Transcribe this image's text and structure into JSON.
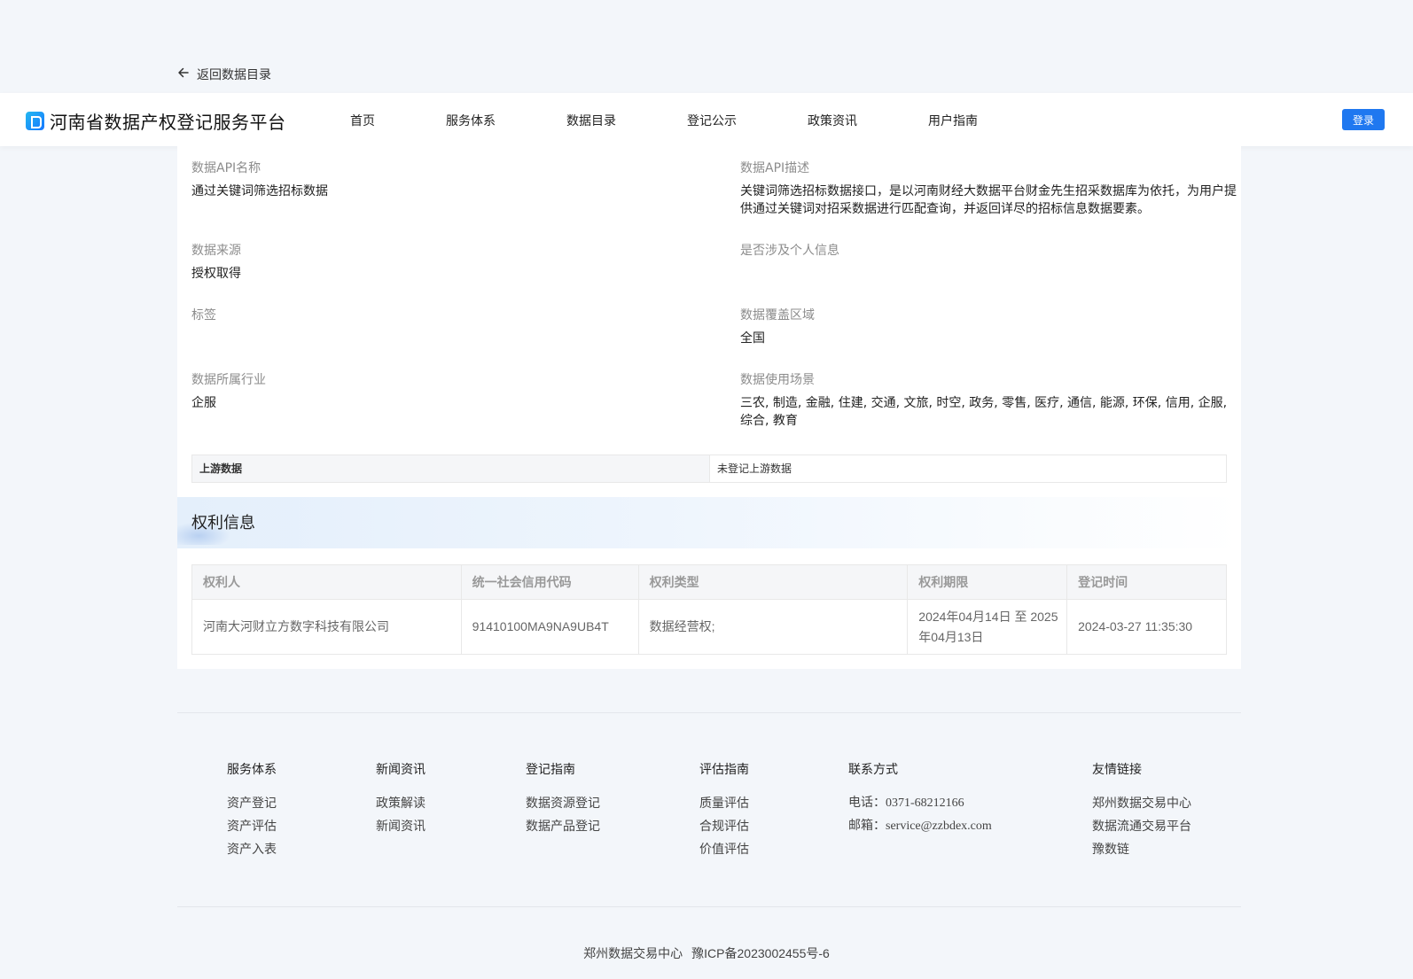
{
  "back_link": {
    "label": "返回数据目录",
    "icon": "arrow-left-icon"
  },
  "header": {
    "title": "河南省数据产权登记服务平台",
    "nav": [
      "首页",
      "服务体系",
      "数据目录",
      "登记公示",
      "政策资讯",
      "用户指南"
    ],
    "login_label": "登录",
    "accent_color": "#1f78f0"
  },
  "details": {
    "api_name_label": "数据API名称",
    "api_name_value": "通过关键词筛选招标数据",
    "api_desc_label": "数据API描述",
    "api_desc_value": "关键词筛选招标数据接口，是以河南财经大数据平台财金先生招采数据库为依托，为用户提供通过关键词对招采数据进行匹配查询，并返回详尽的招标信息数据要素。",
    "source_label": "数据来源",
    "source_value": "授权取得",
    "personal_label": "是否涉及个人信息",
    "personal_value": "",
    "tags_label": "标签",
    "tags_value": "",
    "region_label": "数据覆盖区域",
    "region_value": "全国",
    "industry_label": "数据所属行业",
    "industry_value": "企服",
    "scenario_label": "数据使用场景",
    "scenario_value": "三农, 制造, 金融, 住建, 交通, 文旅, 时空, 政务, 零售, 医疗, 通信, 能源, 环保, 信用, 企服, 综合, 教育"
  },
  "upstream": {
    "label": "上游数据",
    "value": "未登记上游数据"
  },
  "rights": {
    "title": "权利信息",
    "headers": [
      "权利人",
      "统一社会信用代码",
      "权利类型",
      "权利期限",
      "登记时间"
    ],
    "rows": [
      [
        "河南大河财立方数字科技有限公司",
        "91410100MA9NA9UB4T",
        "数据经营权;",
        "2024年04月14日 至 2025年04月13日",
        "2024-03-27 11:35:30"
      ]
    ]
  },
  "footer": {
    "cols": [
      {
        "title": "服务体系",
        "items": [
          "资产登记",
          "资产评估",
          "资产入表"
        ]
      },
      {
        "title": "新闻资讯",
        "items": [
          "政策解读",
          "新闻资讯"
        ]
      },
      {
        "title": "登记指南",
        "items": [
          "数据资源登记",
          "数据产品登记"
        ]
      },
      {
        "title": "评估指南",
        "items": [
          "质量评估",
          "合规评估",
          "价值评估"
        ]
      },
      {
        "title": "联系方式",
        "items": [
          "电话：0371-68212166",
          "邮箱：service@zzbdex.com"
        ]
      },
      {
        "title": "友情链接",
        "items": [
          "郑州数据交易中心",
          "数据流通交易平台",
          "豫数链"
        ]
      }
    ],
    "copyright_org": "郑州数据交易中心",
    "icp": "豫ICP备2023002455号-6"
  }
}
